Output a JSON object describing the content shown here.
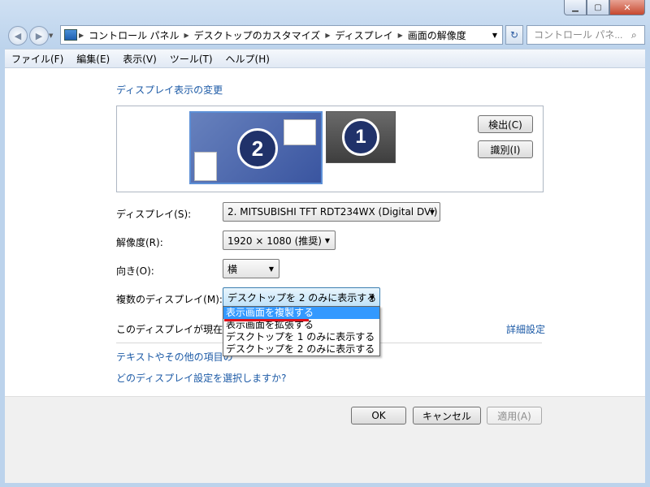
{
  "window": {
    "caption_buttons": {
      "minimize": "minimize-icon",
      "maximize": "maximize-icon",
      "close": "close-icon"
    }
  },
  "navigation": {
    "breadcrumbs": [
      "コントロール パネル",
      "デスクトップのカスタマイズ",
      "ディスプレイ",
      "画面の解像度"
    ],
    "search_placeholder": "コントロール パネ..."
  },
  "menu": [
    "ファイル(F)",
    "編集(E)",
    "表示(V)",
    "ツール(T)",
    "ヘルプ(H)"
  ],
  "main": {
    "heading": "ディスプレイ表示の変更",
    "monitors": [
      {
        "number": "2",
        "selected": true
      },
      {
        "number": "1",
        "selected": false
      }
    ],
    "detect_button": "検出(C)",
    "identify_button": "識別(I)",
    "display_label": "ディスプレイ(S):",
    "display_value": "2. MITSUBISHI TFT RDT234WX (Digital DVI)",
    "resolution_label": "解像度(R):",
    "resolution_value": "1920 × 1080 (推奨)",
    "orientation_label": "向き(O):",
    "orientation_value": "横",
    "multi_label": "複数のディスプレイ(M):",
    "multi_value": "デスクトップを 2 のみに表示する",
    "multi_options": [
      "表示画面を複製する",
      "表示画面を拡張する",
      "デスクトップを 1 のみに表示する",
      "デスクトップを 2 のみに表示する"
    ],
    "primary_text": "このディスプレイが現在メ",
    "advanced_link": "詳細設定",
    "text_size_link": "テキストやその他の項目の",
    "which_settings_link": "どのディスプレイ設定を選択しますか?"
  },
  "footer": {
    "ok": "OK",
    "cancel": "キャンセル",
    "apply": "適用(A)"
  },
  "colors": {
    "link": "#1c5aa6",
    "selection": "#3399ff",
    "underline": "#e0101a"
  }
}
